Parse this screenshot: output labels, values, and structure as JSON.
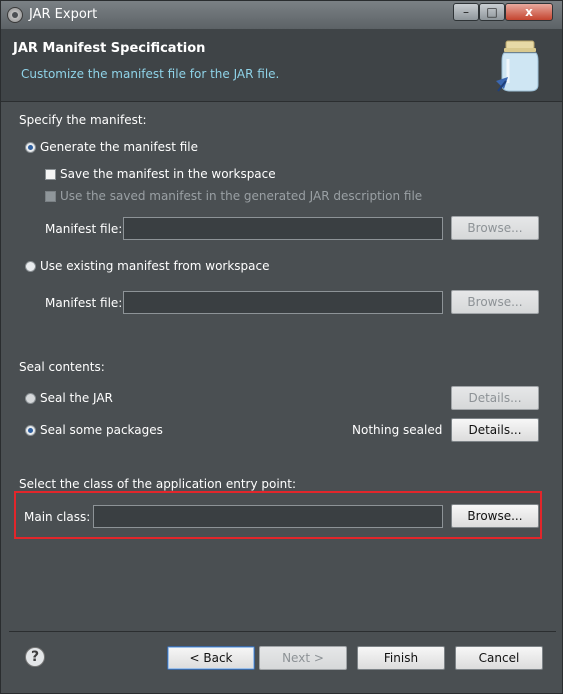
{
  "window": {
    "title": "JAR Export",
    "minimize_glyph": "–",
    "maximize_glyph": "□",
    "close_glyph": "x"
  },
  "header": {
    "title": "JAR Manifest Specification",
    "description": "Customize the manifest file for the JAR file.",
    "icon": "jar-icon"
  },
  "manifest": {
    "section_label": "Specify the manifest:",
    "generate_label": "Generate the manifest file",
    "generate_selected": true,
    "save_in_workspace_label": "Save the manifest in the workspace",
    "save_in_workspace_checked": false,
    "use_saved_label": "Use the saved manifest in the generated JAR description file",
    "manifest_file_label": "Manifest file:",
    "manifest_file_value": "",
    "browse_label": "Browse...",
    "use_existing_label": "Use existing manifest from workspace",
    "use_existing_selected": false,
    "existing_manifest_file_label": "Manifest file:",
    "existing_manifest_file_value": "",
    "existing_browse_label": "Browse..."
  },
  "seal": {
    "section_label": "Seal contents:",
    "seal_jar_label": "Seal the JAR",
    "seal_jar_selected": false,
    "seal_jar_details_label": "Details...",
    "seal_packages_label": "Seal some packages",
    "seal_packages_selected": true,
    "nothing_sealed_label": "Nothing sealed",
    "seal_packages_details_label": "Details..."
  },
  "entry_point": {
    "section_label": "Select the class of the application entry point:",
    "main_class_label": "Main class:",
    "main_class_value": "",
    "browse_label": "Browse..."
  },
  "footer": {
    "help_glyph": "?",
    "back_label": "< Back",
    "next_label": "Next >",
    "finish_label": "Finish",
    "cancel_label": "Cancel"
  },
  "colors": {
    "background": "#4a4f52",
    "header_background": "#3f4447",
    "description_text": "#8fd3e8",
    "highlight_border": "#e2262b"
  }
}
